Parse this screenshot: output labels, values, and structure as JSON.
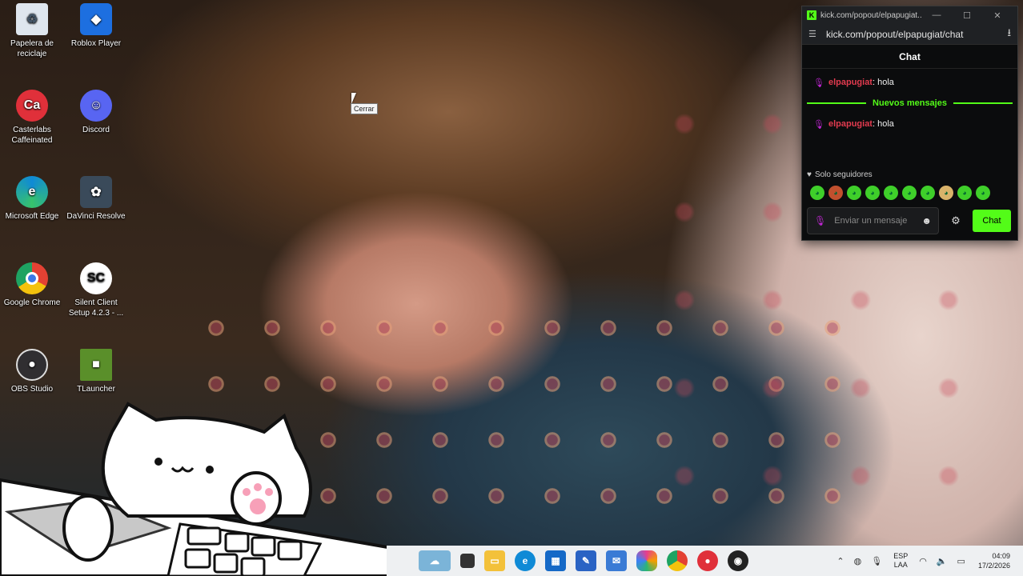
{
  "desktop": {
    "icons": [
      {
        "label": "Papelera de reciclaje",
        "icon": "recycle-bin-icon",
        "color": "#dfe6ee"
      },
      {
        "label": "Roblox Player",
        "icon": "roblox-icon",
        "color": "#1d6fe0"
      },
      {
        "label": "Casterlabs Caffeinated",
        "icon": "casterlabs-icon",
        "color": "#e0303a"
      },
      {
        "label": "Discord",
        "icon": "discord-icon",
        "color": "#5865f2"
      },
      {
        "label": "Microsoft Edge",
        "icon": "edge-icon",
        "color": "#0f8ad6"
      },
      {
        "label": "DaVinci Resolve",
        "icon": "davinci-icon",
        "color": "#3a4a5a"
      },
      {
        "label": "Google Chrome",
        "icon": "chrome-icon",
        "color": "#e34133"
      },
      {
        "label": "Silent Client Setup 4.2.3 - ...",
        "icon": "silent-client-icon",
        "color": "#ffffff"
      },
      {
        "label": "OBS Studio",
        "icon": "obs-icon",
        "color": "#302e31"
      },
      {
        "label": "TLauncher",
        "icon": "tlauncher-icon",
        "color": "#5a8f2a"
      }
    ],
    "tooltip": "Cerrar"
  },
  "popout": {
    "window_title": "kick.com/popout/elpapugiat...",
    "address": "kick.com/popout/elpapugiat/chat",
    "chat_title": "Chat",
    "messages": [
      {
        "user": "elpapugiat",
        "text": ": hola"
      },
      {
        "user": "elpapugiat",
        "text": ": hola"
      }
    ],
    "new_messages": "Nuevos mensajes",
    "followers_only": "Solo seguidores",
    "input_placeholder": "Enviar un mensaje",
    "send_label": "Chat",
    "accent": "#53fc18"
  },
  "taskbar": {
    "apps": [
      "widgets-icon",
      "task-view-icon",
      "file-explorer-icon",
      "edge-icon",
      "store-icon",
      "mail-icon",
      "copilot-icon",
      "chrome-icon",
      "casterlabs-icon",
      "obs-icon"
    ],
    "lang_top": "ESP",
    "lang_bottom": "LAA",
    "time": "04:09",
    "date": "17/2/2026"
  }
}
